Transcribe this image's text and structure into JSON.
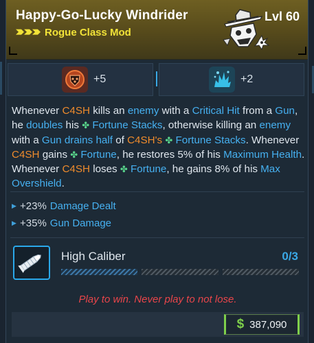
{
  "item": {
    "name": "Happy-Go-Lucky Windrider",
    "level": "Lvl 60",
    "subtitle": "Rogue Class Mod",
    "rarity_color": "#f1e238"
  },
  "stats": [
    {
      "icon": "crest-shield-icon",
      "value": "+5",
      "color": "#e26a2e"
    },
    {
      "icon": "splash-burst-icon",
      "value": "+2",
      "color": "#3ab8e0"
    }
  ],
  "description": {
    "s1": "Whenever ",
    "c4sh": "C4SH",
    "s2": " kills an ",
    "enemy": "enemy",
    "s3": " with a ",
    "critical_hit": "Critical Hit",
    "s4": " from a ",
    "gun": "Gun",
    "s5": ", he ",
    "doubles": "doubles",
    "s6": " his ",
    "fortune_stacks": "Fortune Stacks",
    "s7": ", otherwise killing an ",
    "s8": " with a ",
    "drains": "drains",
    "s9": " ",
    "half": "half",
    "s10": " of ",
    "c4sh_possessive": "C4SH's",
    "s11": ". Whenever ",
    "s12": " gains ",
    "fortune": "Fortune",
    "s13": ", he restores 5% of his ",
    "maximum_health": "Maximum Health",
    "s14": ". Whenever ",
    "s15": " loses ",
    "s16": ", he gains 8% of his ",
    "max_overshield": "Max Overshield",
    "s17": "."
  },
  "bonuses": [
    {
      "value": "+23%",
      "name": "Damage Dealt"
    },
    {
      "value": "+35%",
      "name": "Gun Damage"
    }
  ],
  "skill": {
    "name": "High Caliber",
    "count": "0/3",
    "icon": "bullet-icon",
    "points_filled": 0,
    "points_max": 3
  },
  "flavor": "Play to win. Never play to not lose.",
  "price": {
    "symbol": "$",
    "amount": "387,090"
  }
}
